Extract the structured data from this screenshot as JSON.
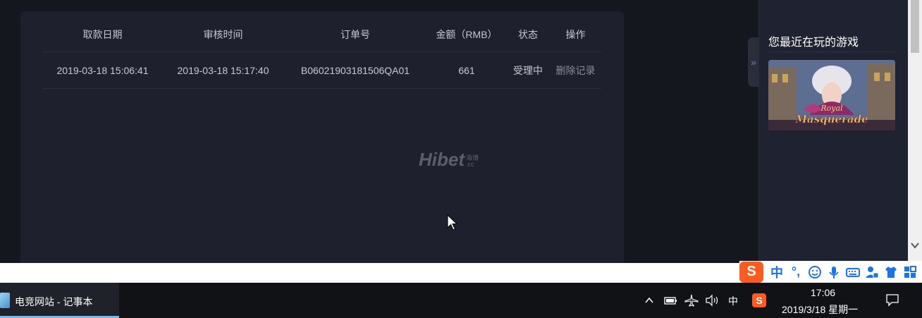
{
  "table": {
    "headers": [
      "取款日期",
      "审核时间",
      "订单号",
      "金额（RMB）",
      "状态",
      "操作"
    ],
    "rows": [
      {
        "withdraw_date": "2019-03-18 15:06:41",
        "review_time": "2019-03-18 15:17:40",
        "order_no": "B06021903181506QA01",
        "amount": "661",
        "status": "受理中",
        "action": "删除记录"
      }
    ]
  },
  "watermark": {
    "main": "Hibet",
    "sub_top": "海博",
    "sub_bottom": ".cc"
  },
  "sidebar": {
    "title": "您最近在玩的游戏",
    "collapse_label": "»",
    "game": {
      "name_line1": "Royal",
      "name_line2": "Masquerade"
    }
  },
  "ime": {
    "logo": "S",
    "mode": "中",
    "punct": "°,",
    "icons": [
      "smile-icon",
      "mic-icon",
      "keyboard-icon",
      "user-icon",
      "shirt-icon",
      "grid-icon"
    ]
  },
  "taskbar": {
    "active_window": "电竞网站 - 记事本",
    "tray_lang": "中",
    "time": "17:06",
    "date": "2019/3/18 星期一"
  },
  "colors": {
    "panel": "#1e212d",
    "page": "#15171f",
    "accent": "#76b9ed",
    "ime": "#ff5a1f"
  }
}
